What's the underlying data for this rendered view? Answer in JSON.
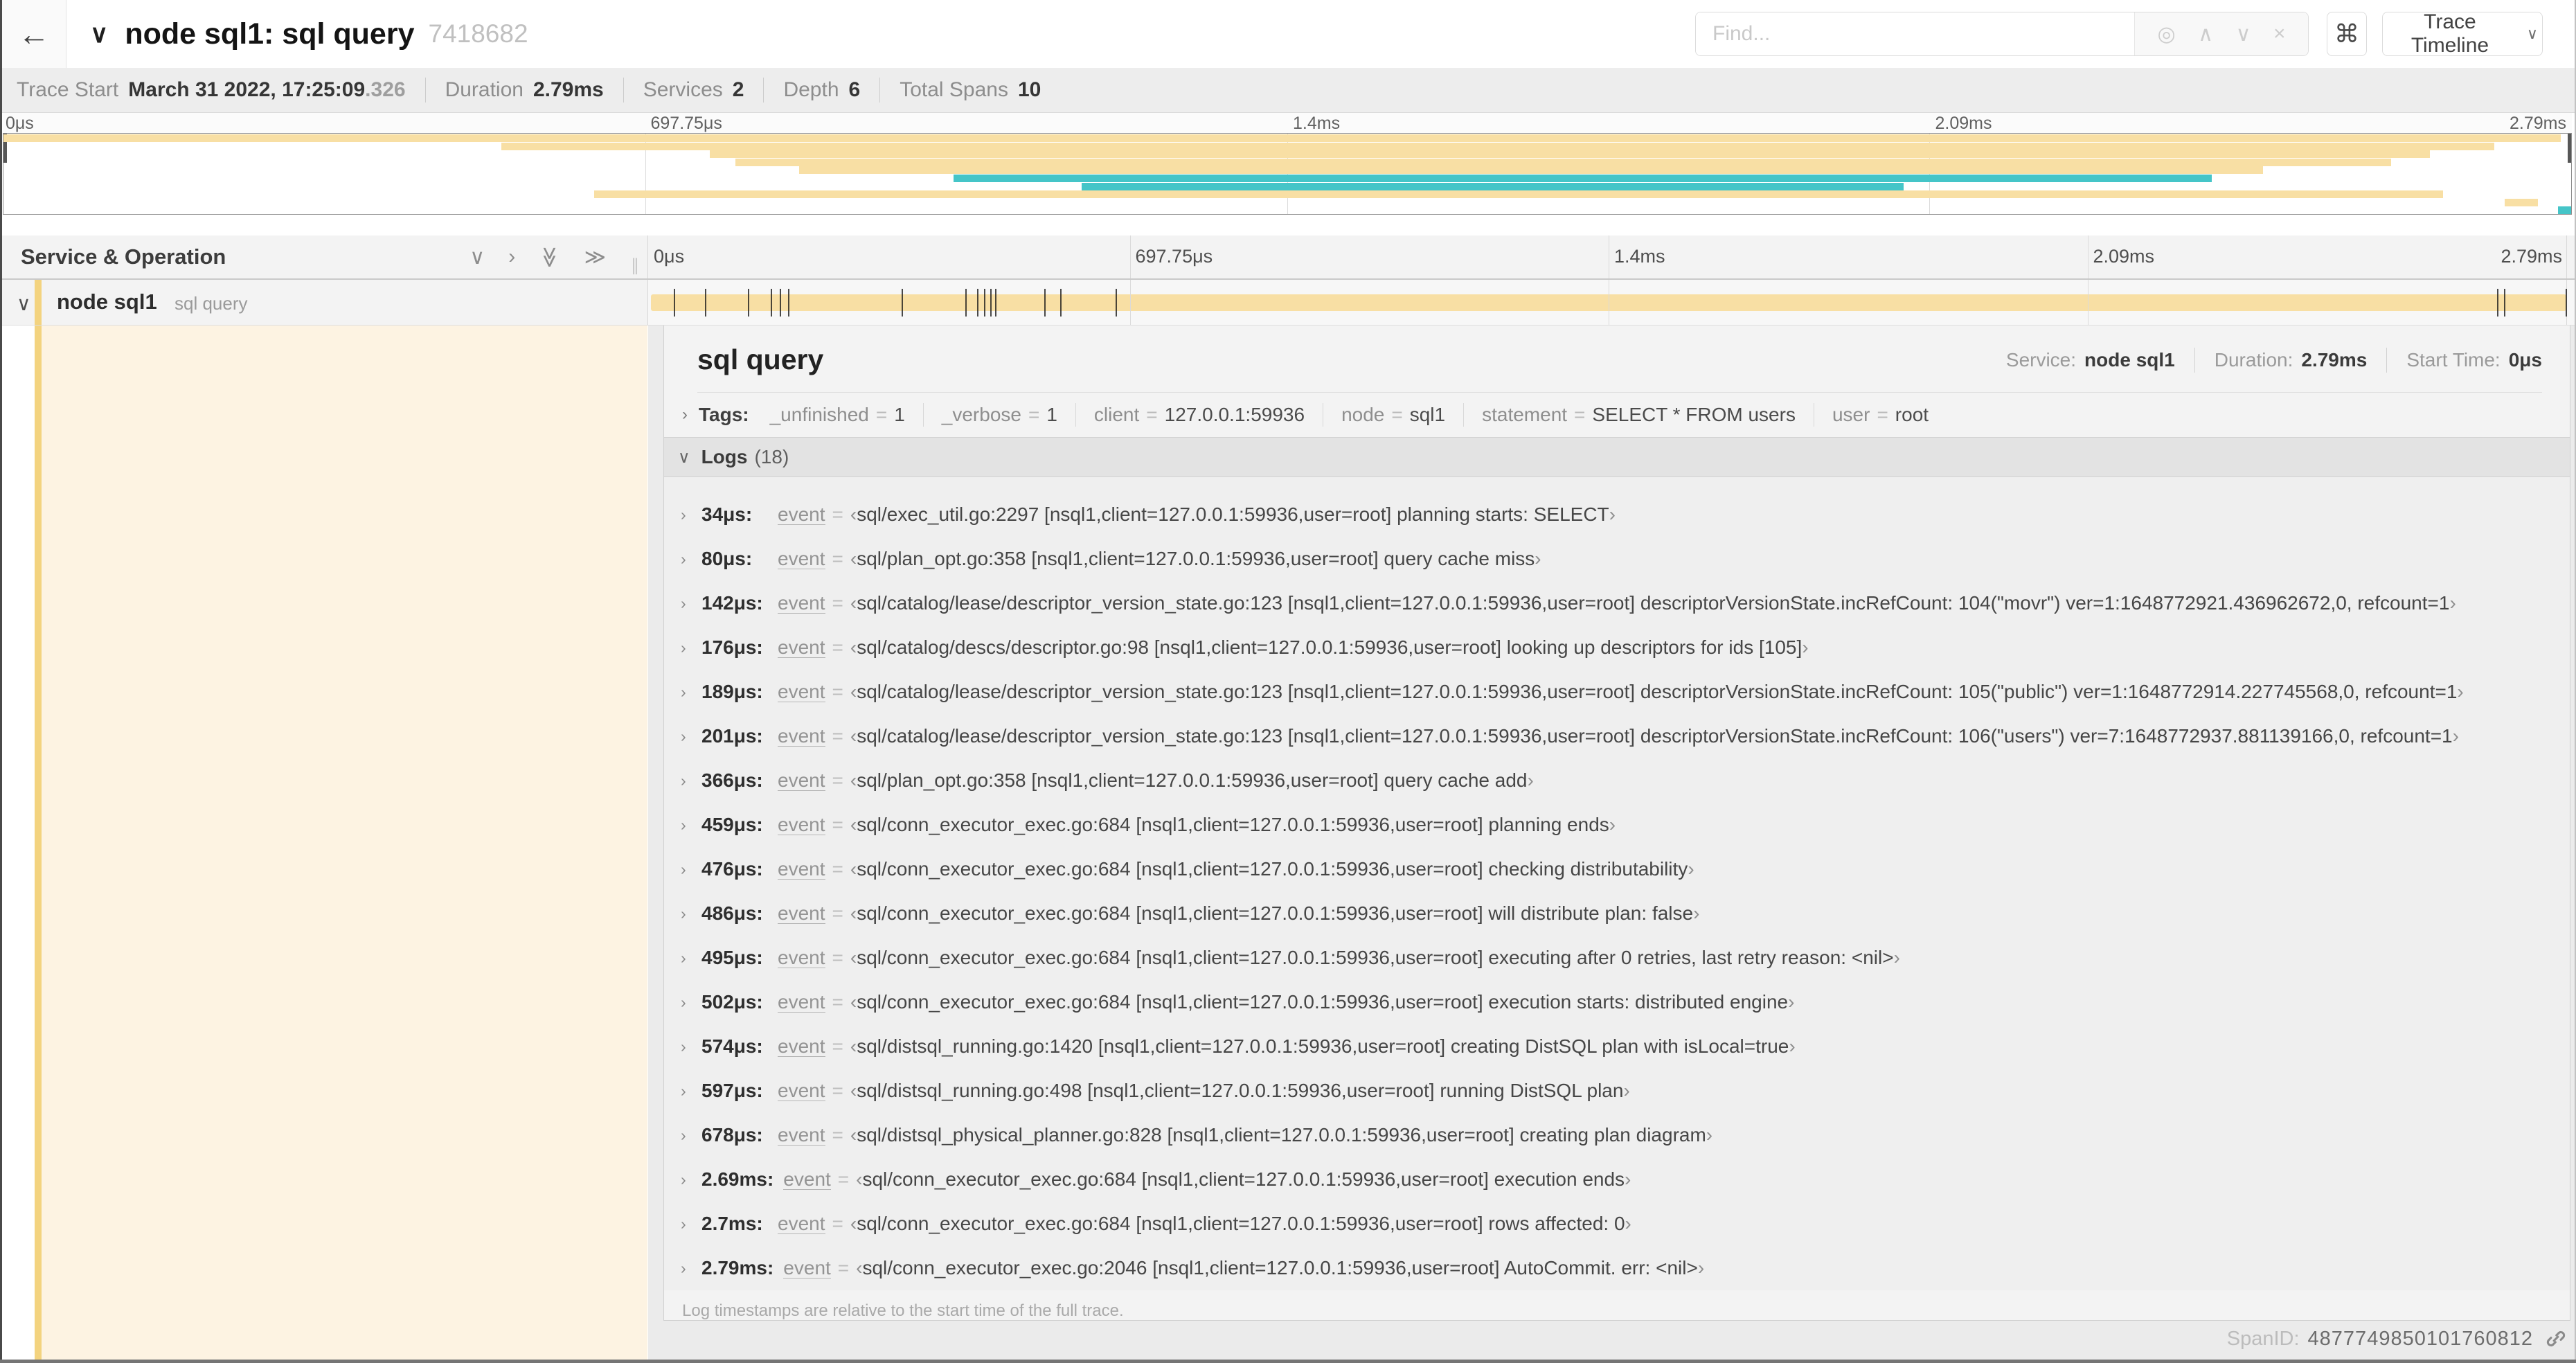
{
  "colors": {
    "span_bar_tan": "#f8dfa4",
    "span_bar_teal": "#45c5c8",
    "accent_strip": "#f3d37f",
    "left_panel_cream": "#fdf3e2"
  },
  "icons": {
    "back": "←",
    "collapse": "∨",
    "chevron_down": "∨",
    "chevron_right": "›",
    "double_chevron_right": "≫",
    "crosshair": "◎",
    "prev": "∧",
    "next": "∨",
    "close": "×",
    "command": "⌘",
    "resizer": "∥"
  },
  "header": {
    "title": "node sql1: sql query",
    "trace_id": "7418682",
    "find_placeholder": "Find...",
    "view_selector": "Trace Timeline"
  },
  "trace_info": {
    "items": [
      {
        "label": "Trace Start",
        "value": "March 31 2022, 17:25:09",
        "suffix": ".326"
      },
      {
        "label": "Duration",
        "value": "2.79ms",
        "suffix": ""
      },
      {
        "label": "Services",
        "value": "2",
        "suffix": ""
      },
      {
        "label": "Depth",
        "value": "6",
        "suffix": ""
      },
      {
        "label": "Total Spans",
        "value": "10",
        "suffix": ""
      }
    ]
  },
  "minimap": {
    "ticks": [
      {
        "label": "0μs",
        "pos": 0,
        "align": "left"
      },
      {
        "label": "697.75μs",
        "pos": 25,
        "align": "left"
      },
      {
        "label": "1.4ms",
        "pos": 50,
        "align": "left"
      },
      {
        "label": "2.09ms",
        "pos": 75,
        "align": "left"
      },
      {
        "label": "2.79ms",
        "pos": 100,
        "align": "right"
      }
    ],
    "gridlines_pct": [
      25,
      50,
      75
    ],
    "bars": [
      {
        "row": 0,
        "start": 0,
        "end": 99.6,
        "color": "tan"
      },
      {
        "row": 1,
        "start": 19.4,
        "end": 97,
        "color": "tan"
      },
      {
        "row": 2,
        "start": 27.5,
        "end": 94.5,
        "color": "tan"
      },
      {
        "row": 3,
        "start": 28.5,
        "end": 93,
        "color": "tan"
      },
      {
        "row": 4,
        "start": 31,
        "end": 88,
        "color": "tan"
      },
      {
        "row": 5,
        "start": 37,
        "end": 86,
        "color": "teal"
      },
      {
        "row": 6,
        "start": 42,
        "end": 74,
        "color": "teal"
      },
      {
        "row": 7,
        "start": 23,
        "end": 95,
        "color": "tan"
      },
      {
        "row": 8,
        "start": 97.4,
        "end": 98.7,
        "color": "tan"
      },
      {
        "row": 9,
        "start": 99.5,
        "end": 100,
        "color": "teal"
      }
    ]
  },
  "timeline": {
    "left_header": "Service & Operation",
    "ticks": [
      {
        "label": "0μs",
        "pos": 0,
        "align": "left"
      },
      {
        "label": "697.75μs",
        "pos": 25,
        "align": "left"
      },
      {
        "label": "1.4ms",
        "pos": 50,
        "align": "left"
      },
      {
        "label": "2.09ms",
        "pos": 75,
        "align": "left"
      },
      {
        "label": "2.79ms",
        "pos": 100,
        "align": "right"
      }
    ],
    "gridlines_pct": [
      25,
      50,
      75,
      100
    ],
    "span": {
      "service": "node sql1",
      "operation": "sql query",
      "duration_us": 2790,
      "log_ticks_us": [
        34,
        80,
        142,
        176,
        189,
        201,
        366,
        459,
        476,
        486,
        495,
        502,
        574,
        597,
        678,
        2690,
        2700,
        2790
      ]
    }
  },
  "detail": {
    "title": "sql query",
    "overview": [
      {
        "label": "Service:",
        "value": "node sql1"
      },
      {
        "label": "Duration:",
        "value": "2.79ms"
      },
      {
        "label": "Start Time:",
        "value": "0μs"
      }
    ],
    "tags": {
      "label": "Tags:",
      "items": [
        {
          "key": "_unfinished",
          "value": "1"
        },
        {
          "key": "_verbose",
          "value": "1"
        },
        {
          "key": "client",
          "value": "127.0.0.1:59936"
        },
        {
          "key": "node",
          "value": "sql1"
        },
        {
          "key": "statement",
          "value": "SELECT * FROM users"
        },
        {
          "key": "user",
          "value": "root"
        }
      ]
    },
    "logs": {
      "label": "Logs",
      "count": "(18)",
      "quote_open": "‹",
      "quote_close": "›",
      "entries": [
        {
          "time": "34μs:",
          "key": "event",
          "value": "sql/exec_util.go:2297 [nsql1,client=127.0.0.1:59936,user=root] planning starts: SELECT"
        },
        {
          "time": "80μs:",
          "key": "event",
          "value": "sql/plan_opt.go:358 [nsql1,client=127.0.0.1:59936,user=root] query cache miss"
        },
        {
          "time": "142μs:",
          "key": "event",
          "value": "sql/catalog/lease/descriptor_version_state.go:123 [nsql1,client=127.0.0.1:59936,user=root] descriptorVersionState.incRefCount: 104(\"movr\") ver=1:1648772921.436962672,0, refcount=1"
        },
        {
          "time": "176μs:",
          "key": "event",
          "value": "sql/catalog/descs/descriptor.go:98 [nsql1,client=127.0.0.1:59936,user=root] looking up descriptors for ids [105]"
        },
        {
          "time": "189μs:",
          "key": "event",
          "value": "sql/catalog/lease/descriptor_version_state.go:123 [nsql1,client=127.0.0.1:59936,user=root] descriptorVersionState.incRefCount: 105(\"public\") ver=1:1648772914.227745568,0, refcount=1"
        },
        {
          "time": "201μs:",
          "key": "event",
          "value": "sql/catalog/lease/descriptor_version_state.go:123 [nsql1,client=127.0.0.1:59936,user=root] descriptorVersionState.incRefCount: 106(\"users\") ver=7:1648772937.881139166,0, refcount=1"
        },
        {
          "time": "366μs:",
          "key": "event",
          "value": "sql/plan_opt.go:358 [nsql1,client=127.0.0.1:59936,user=root] query cache add"
        },
        {
          "time": "459μs:",
          "key": "event",
          "value": "sql/conn_executor_exec.go:684 [nsql1,client=127.0.0.1:59936,user=root] planning ends"
        },
        {
          "time": "476μs:",
          "key": "event",
          "value": "sql/conn_executor_exec.go:684 [nsql1,client=127.0.0.1:59936,user=root] checking distributability"
        },
        {
          "time": "486μs:",
          "key": "event",
          "value": "sql/conn_executor_exec.go:684 [nsql1,client=127.0.0.1:59936,user=root] will distribute plan: false"
        },
        {
          "time": "495μs:",
          "key": "event",
          "value": "sql/conn_executor_exec.go:684 [nsql1,client=127.0.0.1:59936,user=root] executing after 0 retries, last retry reason: <nil>"
        },
        {
          "time": "502μs:",
          "key": "event",
          "value": "sql/conn_executor_exec.go:684 [nsql1,client=127.0.0.1:59936,user=root] execution starts: distributed engine"
        },
        {
          "time": "574μs:",
          "key": "event",
          "value": "sql/distsql_running.go:1420 [nsql1,client=127.0.0.1:59936,user=root] creating DistSQL plan with isLocal=true"
        },
        {
          "time": "597μs:",
          "key": "event",
          "value": "sql/distsql_running.go:498 [nsql1,client=127.0.0.1:59936,user=root] running DistSQL plan"
        },
        {
          "time": "678μs:",
          "key": "event",
          "value": "sql/distsql_physical_planner.go:828 [nsql1,client=127.0.0.1:59936,user=root] creating plan diagram"
        },
        {
          "time": "2.69ms:",
          "key": "event",
          "value": "sql/conn_executor_exec.go:684 [nsql1,client=127.0.0.1:59936,user=root] execution ends"
        },
        {
          "time": "2.7ms:",
          "key": "event",
          "value": "sql/conn_executor_exec.go:684 [nsql1,client=127.0.0.1:59936,user=root] rows affected: 0"
        },
        {
          "time": "2.79ms:",
          "key": "event",
          "value": "sql/conn_executor_exec.go:2046 [nsql1,client=127.0.0.1:59936,user=root] AutoCommit. err: <nil>"
        }
      ],
      "footer": "Log timestamps are relative to the start time of the full trace."
    },
    "span_id_label": "SpanID:",
    "span_id": "4877749850101760812"
  }
}
